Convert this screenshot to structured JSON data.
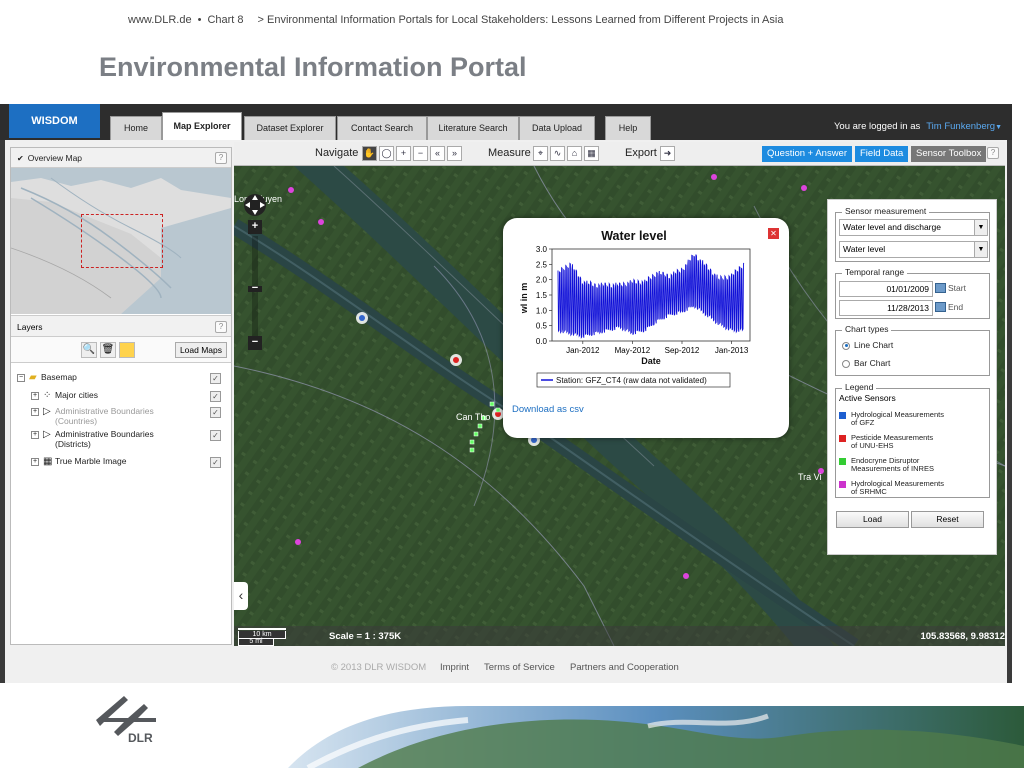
{
  "slide": {
    "source": "www.DLR.de",
    "bullet": "•",
    "chart": "Chart 8",
    "subtitle": "> Environmental Information Portals for Local Stakeholders: Lessons Learned from Different Projects in Asia",
    "title": "Environmental Information Portal"
  },
  "app": {
    "logo": "WISDOM",
    "tabs": [
      "Home",
      "Map Explorer",
      "Dataset Explorer",
      "Contact Search",
      "Literature Search",
      "Data Upload",
      "Help"
    ],
    "active_tab": "Map Explorer",
    "login_text": "You are logged in as",
    "user": "Tim Funkenberg"
  },
  "left_panel": {
    "overview_title": "Overview Map",
    "layers_title": "Layers",
    "help": "?",
    "load_maps": "Load Maps",
    "layers": [
      {
        "label": "Basemap",
        "checked": "✓"
      },
      {
        "label": "Major cities",
        "checked": "✓"
      },
      {
        "label": "Administrative Boundaries",
        "label2": "(Countries)",
        "checked": "✓"
      },
      {
        "label": "Administrative Boundaries",
        "label2": "(Districts)",
        "checked": "✓"
      },
      {
        "label": "True Marble Image",
        "checked": "✓"
      }
    ]
  },
  "map_toolbar": {
    "navigate": "Navigate",
    "measure": "Measure",
    "export": "Export",
    "buttons": [
      "Question + Answer",
      "Field Data",
      "Sensor Toolbox"
    ],
    "help": "?"
  },
  "map": {
    "place_labels": [
      "Long Xuyen",
      "Can Tho",
      "Tra Vi"
    ],
    "scale_km": "10 km",
    "scale_mi": "5 mi",
    "scale_text": "Scale = 1 : 375K",
    "coords": "105.83568, 9.98312"
  },
  "popup": {
    "title": "Water level",
    "ylabel": "wl in m",
    "xlabel": "Date",
    "legend": "Station: GFZ_CT4 (raw data not validated)",
    "download": "Download as csv",
    "close": "✕"
  },
  "chart_data": {
    "type": "line",
    "title": "Water level",
    "xlabel": "Date",
    "ylabel": "wl in m",
    "x_ticks": [
      "Jan-2012",
      "May-2012",
      "Sep-2012",
      "Jan-2013"
    ],
    "y_ticks": [
      "0.0",
      "0.5",
      "1.0",
      "1.5",
      "2.0",
      "2.5",
      "3.0"
    ],
    "ylim": [
      0,
      3
    ],
    "series": [
      {
        "name": "Station: GFZ_CT4 (raw data not validated)",
        "color": "#1010d8",
        "x": [
          "2011-11",
          "2011-12",
          "2012-01",
          "2012-02",
          "2012-03",
          "2012-04",
          "2012-05",
          "2012-06",
          "2012-07",
          "2012-08",
          "2012-09",
          "2012-10",
          "2012-11",
          "2012-12",
          "2013-01",
          "2013-02"
        ],
        "high": [
          2.3,
          2.6,
          2.0,
          1.9,
          1.9,
          1.9,
          2.0,
          2.0,
          2.3,
          2.2,
          2.4,
          2.9,
          2.5,
          2.1,
          2.2,
          2.6
        ],
        "low": [
          0.3,
          0.2,
          0.1,
          0.2,
          0.3,
          0.4,
          0.2,
          0.3,
          0.6,
          0.8,
          0.9,
          1.1,
          0.8,
          0.5,
          0.3,
          0.3
        ]
      }
    ]
  },
  "toolbox": {
    "sensor_title": "Sensor measurement",
    "sensor_select1": "Water level and discharge",
    "sensor_select2": "Water level",
    "temporal_title": "Temporal range",
    "start_date": "01/01/2009",
    "start_label": "Start",
    "end_date": "11/28/2013",
    "end_label": "End",
    "chart_types_title": "Chart types",
    "chart_type_line": "Line Chart",
    "chart_type_bar": "Bar Chart",
    "legend_title": "Legend",
    "active_sensors": "Active Sensors",
    "legend_items": [
      {
        "l1": "Hydrological Measurements",
        "l2": "of GFZ",
        "color": "#1d5fd0"
      },
      {
        "l1": "Pesticide Measurements",
        "l2": "of UNU-EHS",
        "color": "#d22"
      },
      {
        "l1": "Endocryne Disruptor",
        "l2": "Measurements of INRES",
        "color": "#3c3"
      },
      {
        "l1": "Hydrological Measurements",
        "l2": "of SRHMC",
        "color": "#c3c"
      }
    ],
    "load": "Load",
    "reset": "Reset"
  },
  "footer": {
    "copyright": "© 2013 DLR WISDOM",
    "links": [
      "Imprint",
      "Terms of Service",
      "Partners and Cooperation"
    ]
  },
  "branding": {
    "dlr": "DLR"
  }
}
